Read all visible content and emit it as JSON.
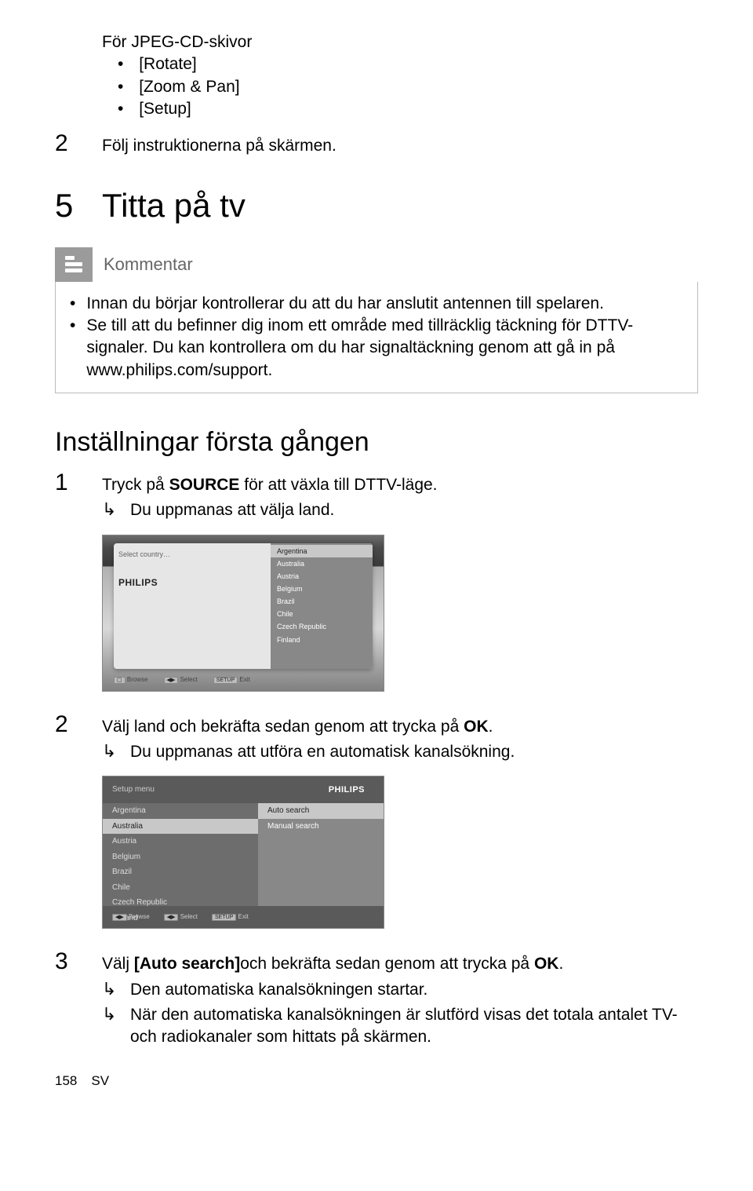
{
  "jpeg": {
    "heading": "För JPEG-CD-skivor",
    "items": [
      "[Rotate]",
      "[Zoom & Pan]",
      "[Setup]"
    ]
  },
  "step_follow": {
    "num": "2",
    "text": "Följ instruktionerna på skärmen."
  },
  "chapter": {
    "num": "5",
    "title": "Titta på tv"
  },
  "note": {
    "label": "Kommentar",
    "items": [
      "Innan du börjar kontrollerar du att du har anslutit antennen till spelaren.",
      "Se till att du befinner dig inom ett område med tillräcklig täckning för DTTV-signaler. Du kan kontrollera om du har signaltäckning genom att gå in på www.philips.com/support."
    ]
  },
  "section1": {
    "title": "Inställningar första gången",
    "step1_num": "1",
    "step1_pre": "Tryck på ",
    "step1_bold": "SOURCE",
    "step1_post": " för att växla till DTTV-läge.",
    "step1_sub": "Du uppmanas att välja land."
  },
  "shot1": {
    "left_label": "Select country…",
    "logo": "PHILIPS",
    "options": [
      "Argentina",
      "Australia",
      "Austria",
      "Belgium",
      "Brazil",
      "Chile",
      "Czech Republic",
      "Finland"
    ],
    "footer": {
      "b1": "Browse",
      "b2": "Select",
      "b3": "Exit",
      "k1": "▢",
      "k2": "◀▶",
      "k3": "SETUP"
    }
  },
  "step2": {
    "num": "2",
    "pre": "Välj land och bekräfta sedan genom att trycka på ",
    "bold": "OK",
    "post": ".",
    "sub": "Du uppmanas att utföra en automatisk kanalsökning."
  },
  "shot2": {
    "title": "Setup menu",
    "logo": "PHILIPS",
    "left": [
      "Argentina",
      "Australia",
      "Austria",
      "Belgium",
      "Brazil",
      "Chile",
      "Czech Republic",
      "Finland"
    ],
    "right": [
      "Auto search",
      "Manual search"
    ],
    "footer": {
      "b1": "Browse",
      "b2": "Select",
      "b3": "Exit",
      "k1": "◀▶",
      "k2": "◀▶",
      "k3": "SETUP"
    }
  },
  "step3": {
    "num": "3",
    "pre": "Välj ",
    "bold1": "[Auto search]",
    "mid": "och bekräfta sedan genom att trycka på ",
    "bold2": "OK",
    "post": ".",
    "sub1": "Den automatiska kanalsökningen startar.",
    "sub2": "När den automatiska kanalsökningen är slutförd visas det totala antalet TV- och radiokanaler som hittats på skärmen."
  },
  "footer": {
    "page": "158",
    "lang": "SV"
  }
}
